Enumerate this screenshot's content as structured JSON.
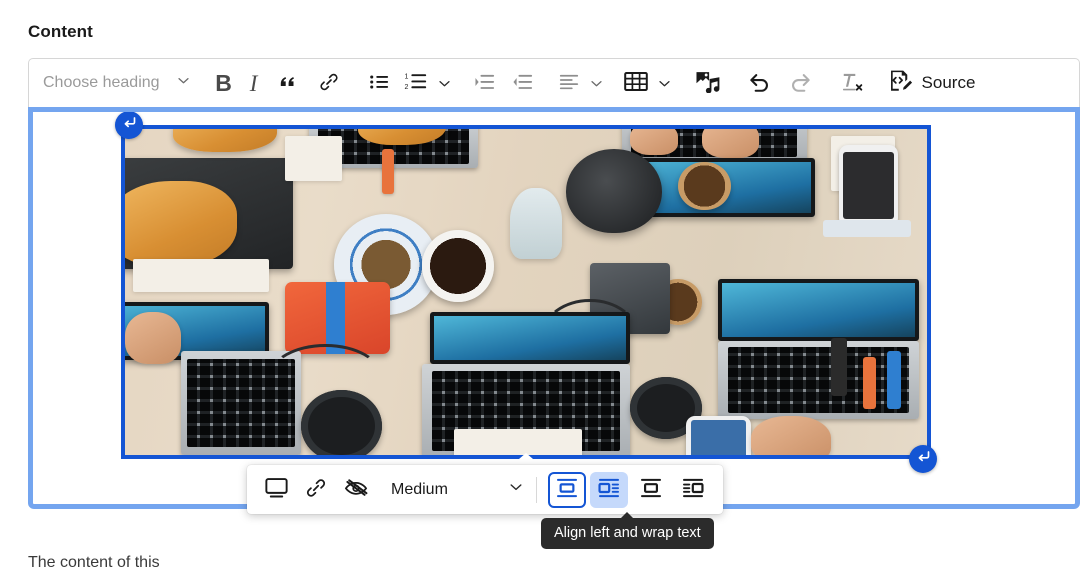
{
  "field": {
    "label": "Content"
  },
  "toolbar": {
    "heading": {
      "placeholder": "Choose heading",
      "chevron": "chevron-down-icon"
    },
    "items": [
      {
        "name": "bold",
        "label": "B",
        "icon": "bold-icon"
      },
      {
        "name": "italic",
        "label": "I",
        "icon": "italic-icon"
      },
      {
        "name": "block-quote",
        "label": "“",
        "icon": "block-quote-icon"
      },
      {
        "name": "link",
        "label": "",
        "icon": "link-icon"
      },
      {
        "name": "bulleted-list",
        "label": "",
        "icon": "bulleted-list-icon"
      },
      {
        "name": "numbered-list",
        "label": "",
        "icon": "numbered-list-icon"
      },
      {
        "name": "list-options",
        "label": "",
        "icon": "chevron-down-icon"
      },
      {
        "name": "increase-indent",
        "label": "",
        "icon": "increase-indent-icon"
      },
      {
        "name": "decrease-indent",
        "label": "",
        "icon": "decrease-indent-icon"
      },
      {
        "name": "text-alignment",
        "label": "",
        "icon": "align-left-icon"
      },
      {
        "name": "alignment-options",
        "label": "",
        "icon": "chevron-down-icon"
      },
      {
        "name": "insert-table",
        "label": "",
        "icon": "table-icon"
      },
      {
        "name": "table-options",
        "label": "",
        "icon": "chevron-down-icon"
      },
      {
        "name": "insert-media",
        "label": "",
        "icon": "media-library-icon"
      },
      {
        "name": "undo",
        "label": "",
        "icon": "undo-icon"
      },
      {
        "name": "redo",
        "label": "",
        "icon": "redo-icon"
      },
      {
        "name": "remove-format",
        "label": "",
        "icon": "remove-format-icon"
      }
    ],
    "source": {
      "label": "Source",
      "icon": "source-code-icon"
    }
  },
  "image_widget": {
    "alt": "Top-down photo of a wooden desk covered with laptops, a phone, a bowl of nuts, coffee cups, a teapot, headphones and notebooks",
    "selected": true,
    "handle_icon": "return-arrow-icon",
    "resize_handle": "resize-handle"
  },
  "balloon_toolbar": {
    "buttons": [
      {
        "name": "display-settings",
        "icon": "monitor-icon",
        "label": ""
      },
      {
        "name": "image-link",
        "icon": "link-icon",
        "label": ""
      },
      {
        "name": "decorative-image",
        "icon": "eye-slash-icon",
        "label": ""
      }
    ],
    "size": {
      "value": "Medium",
      "chevron": "chevron-down-icon"
    },
    "alignment": [
      {
        "name": "break-text",
        "icon": "align-break-text-icon",
        "state": "focused"
      },
      {
        "name": "align-left-wrap-text",
        "icon": "align-left-wrap-icon",
        "state": "active"
      },
      {
        "name": "align-center",
        "icon": "align-center-icon",
        "state": "default"
      },
      {
        "name": "align-right-wrap-text",
        "icon": "align-right-wrap-icon",
        "state": "default"
      }
    ]
  },
  "tooltip": {
    "text": "Align left and wrap text"
  },
  "body_text": {
    "paragraph": "The content of this"
  },
  "colors": {
    "accent_blue": "#1455d4",
    "focus_ring_blue": "#74a5ef",
    "active_bg_blue": "#c5d9fb",
    "tooltip_bg": "#2b2b2b",
    "toolbar_border": "#d6d6d6",
    "placeholder_gray": "#9a9a9a"
  }
}
